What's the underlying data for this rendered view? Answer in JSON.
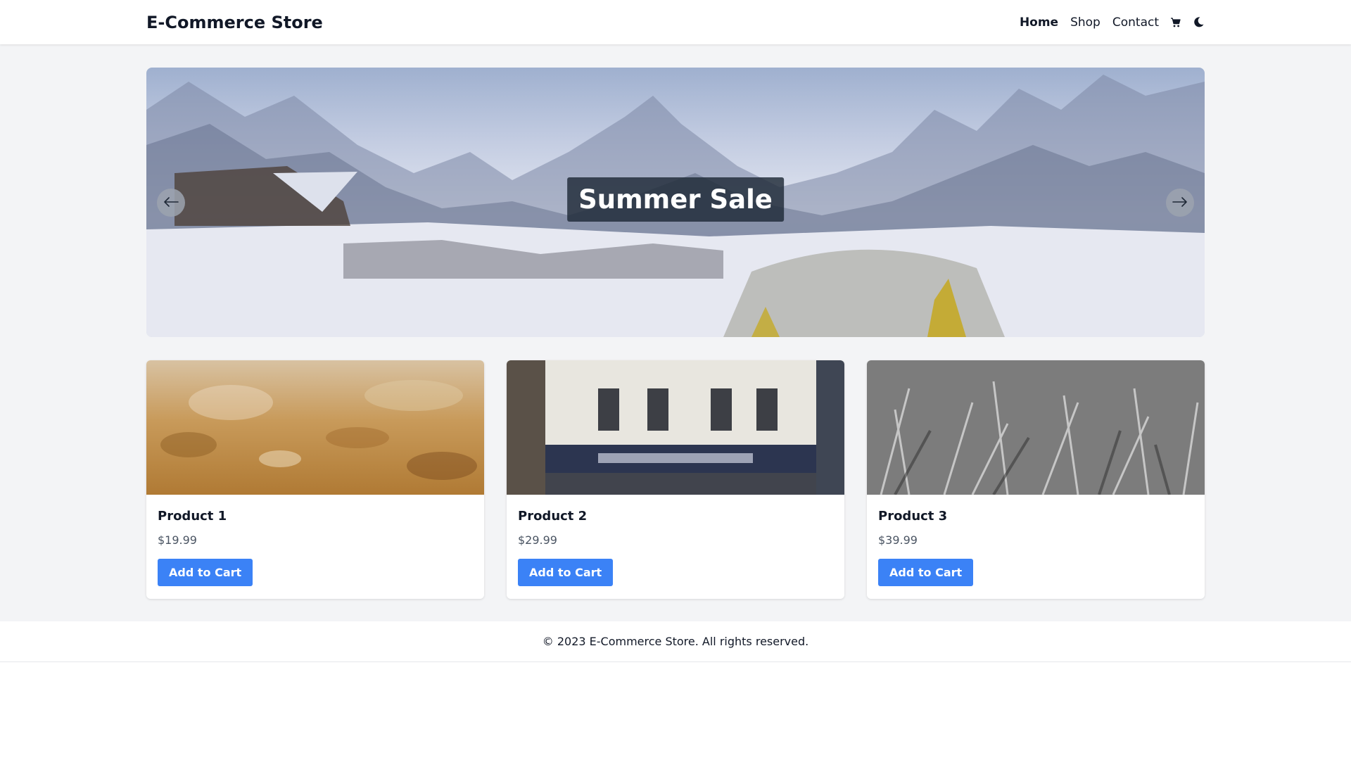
{
  "header": {
    "brand": "E-Commerce Store",
    "nav": [
      {
        "label": "Home",
        "active": true
      },
      {
        "label": "Shop",
        "active": false
      },
      {
        "label": "Contact",
        "active": false
      }
    ],
    "icons": [
      "cart-icon",
      "moon-icon"
    ]
  },
  "hero": {
    "caption": "Summer Sale",
    "prev_icon": "arrow-left-icon",
    "next_icon": "arrow-right-icon"
  },
  "products": [
    {
      "name": "Product 1",
      "price": "$19.99",
      "button": "Add to Cart"
    },
    {
      "name": "Product 2",
      "price": "$29.99",
      "button": "Add to Cart"
    },
    {
      "name": "Product 3",
      "price": "$39.99",
      "button": "Add to Cart"
    }
  ],
  "footer": {
    "text": "© 2023 E-Commerce Store. All rights reserved."
  },
  "colors": {
    "accent": "#3b82f6",
    "page_bg": "#f3f4f6",
    "caption_bg": "#1f2937"
  }
}
